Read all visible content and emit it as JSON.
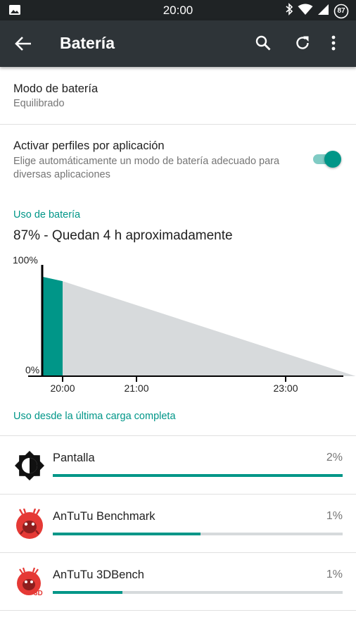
{
  "status_bar": {
    "time": "20:00",
    "battery_level": "87"
  },
  "app_bar": {
    "title": "Batería"
  },
  "battery_mode": {
    "title": "Modo de batería",
    "value": "Equilibrado"
  },
  "app_profiles": {
    "title": "Activar perfiles por aplicación",
    "description": "Elige automáticamente un modo de batería adecuado para diversas aplicaciones",
    "enabled": true
  },
  "battery_usage": {
    "section_title": "Uso de batería",
    "status": "87% - Quedan 4 h aproximadamente"
  },
  "chart_data": {
    "type": "area",
    "y_tick_labels": [
      "100%",
      "0%"
    ],
    "x_tick_labels": [
      "20:00",
      "21:00",
      "23:00"
    ],
    "ylim": [
      0,
      100
    ],
    "measured": [
      {
        "x": "19:44",
        "y": 91
      },
      {
        "x": "20:00",
        "y": 87
      }
    ],
    "projected": [
      {
        "x": "20:00",
        "y": 87
      },
      {
        "x": "23:58",
        "y": 0
      }
    ],
    "colors": {
      "measured": "#009688",
      "projected": "#d7dadc"
    }
  },
  "usage_since_charge": {
    "section_title": "Uso desde la última carga completa",
    "items": [
      {
        "name": "Pantalla",
        "percent_label": "2%",
        "bar_fraction": 1.0,
        "icon": "brightness-icon"
      },
      {
        "name": "AnTuTu Benchmark",
        "percent_label": "1%",
        "bar_fraction": 0.51,
        "icon": "antutu-icon"
      },
      {
        "name": "AnTuTu 3DBench",
        "percent_label": "1%",
        "bar_fraction": 0.24,
        "icon": "antutu-3dbench-icon",
        "icon_badge": "3D"
      }
    ]
  },
  "colors": {
    "accent": "#009688",
    "toolbar": "#2e3438",
    "statusbar": "#1f2325"
  }
}
